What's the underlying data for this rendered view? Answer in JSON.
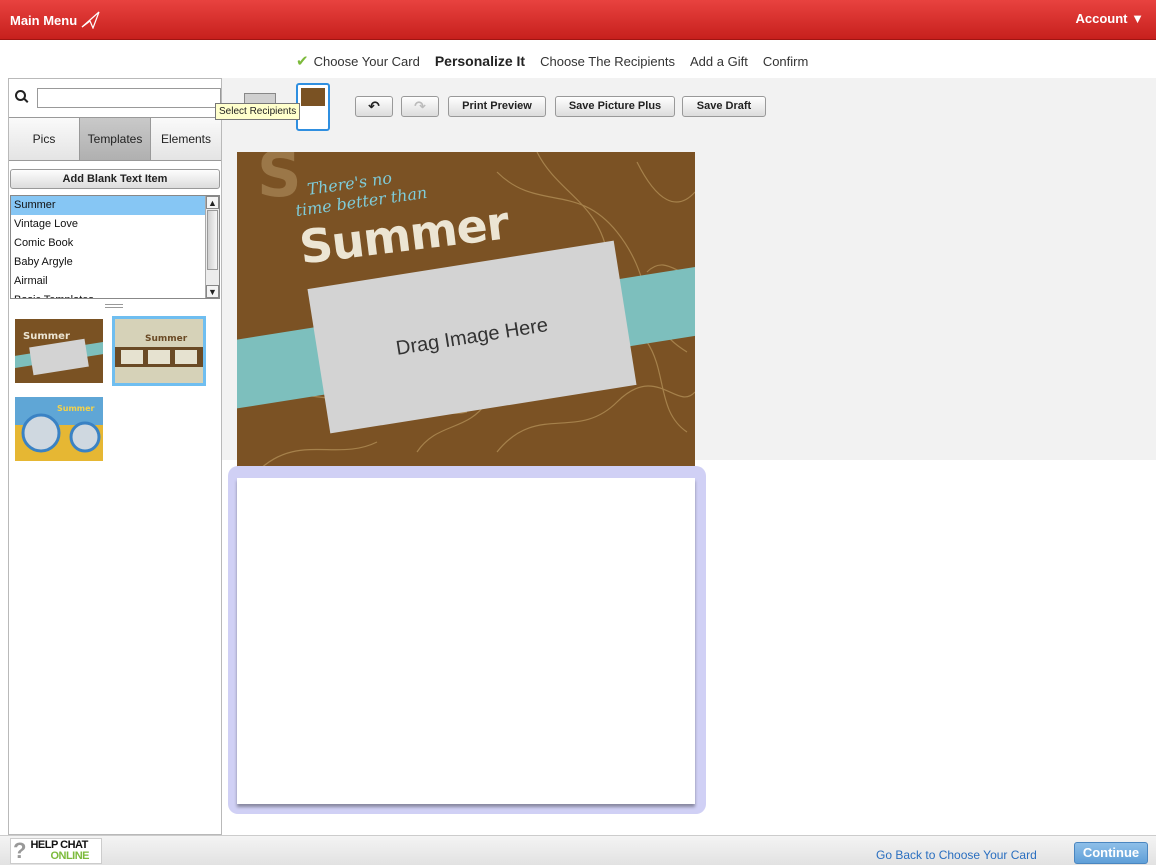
{
  "topbar": {
    "main_menu": "Main Menu",
    "account": "Account ▼"
  },
  "steps": [
    {
      "label": "Choose Your Card",
      "done": true
    },
    {
      "label": "Personalize It",
      "active": true
    },
    {
      "label": "Choose The Recipients"
    },
    {
      "label": "Add a Gift"
    },
    {
      "label": "Confirm"
    }
  ],
  "left_panel": {
    "search": {
      "value": "",
      "placeholder": ""
    },
    "tabs": [
      "Pics",
      "Templates",
      "Elements"
    ],
    "active_tab": "Templates",
    "add_blank_text": "Add Blank Text Item",
    "template_list": [
      "Summer",
      "Vintage Love",
      "Comic Book",
      "Baby Argyle",
      "Airmail",
      "Basic Templates"
    ],
    "selected_template": "Summer"
  },
  "toolbar": {
    "tooltip": "Select Recipients",
    "undo": "↶",
    "redo": "↷",
    "print_preview": "Print Preview",
    "save_picture_plus": "Save Picture Plus",
    "save_draft": "Save Draft"
  },
  "card": {
    "headline_line1": "There's no",
    "headline_line2": "time better than",
    "title": "Summer",
    "drop_zone": "Drag Image Here"
  },
  "bottombar": {
    "help_title": "HELP CHAT",
    "help_status": "ONLINE",
    "go_back": "Go Back to Choose Your Card",
    "continue": "Continue"
  },
  "colors": {
    "topbar": "#c7201d",
    "accent_blue": "#86c6f4",
    "card_brown": "#7b5224",
    "card_teal": "#7dbfbd"
  }
}
